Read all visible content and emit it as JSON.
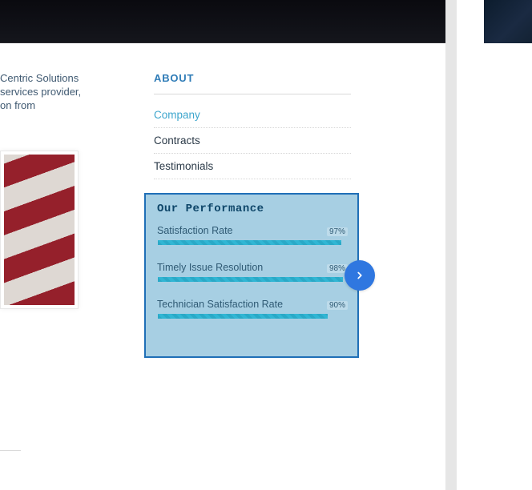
{
  "intro": {
    "line1": "Centric Solutions",
    "line2": "services provider,",
    "line3": "on from"
  },
  "about": {
    "heading": "ABOUT",
    "items": [
      {
        "label": "Company",
        "active": true
      },
      {
        "label": "Contracts",
        "active": false
      },
      {
        "label": "Testimonials",
        "active": false
      }
    ]
  },
  "performance": {
    "title": "Our Performance",
    "metrics": [
      {
        "label": "Satisfaction Rate",
        "value_label": "97%",
        "percent": 97
      },
      {
        "label": "Timely Issue Resolution",
        "value_label": "98%",
        "percent": 98
      },
      {
        "label": "Technician Satisfaction Rate",
        "value_label": "90%",
        "percent": 90
      }
    ]
  },
  "chart_data": {
    "type": "bar",
    "title": "Our Performance",
    "categories": [
      "Satisfaction Rate",
      "Timely Issue Resolution",
      "Technician Satisfaction Rate"
    ],
    "values": [
      97,
      98,
      90
    ],
    "xlabel": "",
    "ylabel": "percent",
    "ylim": [
      0,
      100
    ]
  }
}
